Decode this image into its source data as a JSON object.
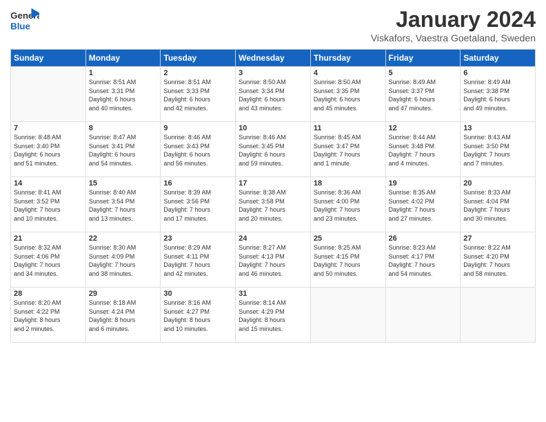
{
  "header": {
    "logo_general": "General",
    "logo_blue": "Blue",
    "month_title": "January 2024",
    "location": "Viskafors, Vaestra Goetaland, Sweden"
  },
  "weekdays": [
    "Sunday",
    "Monday",
    "Tuesday",
    "Wednesday",
    "Thursday",
    "Friday",
    "Saturday"
  ],
  "weeks": [
    [
      {
        "day": "",
        "info": ""
      },
      {
        "day": "1",
        "info": "Sunrise: 8:51 AM\nSunset: 3:31 PM\nDaylight: 6 hours\nand 40 minutes."
      },
      {
        "day": "2",
        "info": "Sunrise: 8:51 AM\nSunset: 3:33 PM\nDaylight: 6 hours\nand 42 minutes."
      },
      {
        "day": "3",
        "info": "Sunrise: 8:50 AM\nSunset: 3:34 PM\nDaylight: 6 hours\nand 43 minutes."
      },
      {
        "day": "4",
        "info": "Sunrise: 8:50 AM\nSunset: 3:35 PM\nDaylight: 6 hours\nand 45 minutes."
      },
      {
        "day": "5",
        "info": "Sunrise: 8:49 AM\nSunset: 3:37 PM\nDaylight: 6 hours\nand 47 minutes."
      },
      {
        "day": "6",
        "info": "Sunrise: 8:49 AM\nSunset: 3:38 PM\nDaylight: 6 hours\nand 49 minutes."
      }
    ],
    [
      {
        "day": "7",
        "info": "Sunrise: 8:48 AM\nSunset: 3:40 PM\nDaylight: 6 hours\nand 51 minutes."
      },
      {
        "day": "8",
        "info": "Sunrise: 8:47 AM\nSunset: 3:41 PM\nDaylight: 6 hours\nand 54 minutes."
      },
      {
        "day": "9",
        "info": "Sunrise: 8:46 AM\nSunset: 3:43 PM\nDaylight: 6 hours\nand 56 minutes."
      },
      {
        "day": "10",
        "info": "Sunrise: 8:46 AM\nSunset: 3:45 PM\nDaylight: 6 hours\nand 59 minutes."
      },
      {
        "day": "11",
        "info": "Sunrise: 8:45 AM\nSunset: 3:47 PM\nDaylight: 7 hours\nand 1 minute."
      },
      {
        "day": "12",
        "info": "Sunrise: 8:44 AM\nSunset: 3:48 PM\nDaylight: 7 hours\nand 4 minutes."
      },
      {
        "day": "13",
        "info": "Sunrise: 8:43 AM\nSunset: 3:50 PM\nDaylight: 7 hours\nand 7 minutes."
      }
    ],
    [
      {
        "day": "14",
        "info": "Sunrise: 8:41 AM\nSunset: 3:52 PM\nDaylight: 7 hours\nand 10 minutes."
      },
      {
        "day": "15",
        "info": "Sunrise: 8:40 AM\nSunset: 3:54 PM\nDaylight: 7 hours\nand 13 minutes."
      },
      {
        "day": "16",
        "info": "Sunrise: 8:39 AM\nSunset: 3:56 PM\nDaylight: 7 hours\nand 17 minutes."
      },
      {
        "day": "17",
        "info": "Sunrise: 8:38 AM\nSunset: 3:58 PM\nDaylight: 7 hours\nand 20 minutes."
      },
      {
        "day": "18",
        "info": "Sunrise: 8:36 AM\nSunset: 4:00 PM\nDaylight: 7 hours\nand 23 minutes."
      },
      {
        "day": "19",
        "info": "Sunrise: 8:35 AM\nSunset: 4:02 PM\nDaylight: 7 hours\nand 27 minutes."
      },
      {
        "day": "20",
        "info": "Sunrise: 8:33 AM\nSunset: 4:04 PM\nDaylight: 7 hours\nand 30 minutes."
      }
    ],
    [
      {
        "day": "21",
        "info": "Sunrise: 8:32 AM\nSunset: 4:06 PM\nDaylight: 7 hours\nand 34 minutes."
      },
      {
        "day": "22",
        "info": "Sunrise: 8:30 AM\nSunset: 4:09 PM\nDaylight: 7 hours\nand 38 minutes."
      },
      {
        "day": "23",
        "info": "Sunrise: 8:29 AM\nSunset: 4:11 PM\nDaylight: 7 hours\nand 42 minutes."
      },
      {
        "day": "24",
        "info": "Sunrise: 8:27 AM\nSunset: 4:13 PM\nDaylight: 7 hours\nand 46 minutes."
      },
      {
        "day": "25",
        "info": "Sunrise: 8:25 AM\nSunset: 4:15 PM\nDaylight: 7 hours\nand 50 minutes."
      },
      {
        "day": "26",
        "info": "Sunrise: 8:23 AM\nSunset: 4:17 PM\nDaylight: 7 hours\nand 54 minutes."
      },
      {
        "day": "27",
        "info": "Sunrise: 8:22 AM\nSunset: 4:20 PM\nDaylight: 7 hours\nand 58 minutes."
      }
    ],
    [
      {
        "day": "28",
        "info": "Sunrise: 8:20 AM\nSunset: 4:22 PM\nDaylight: 8 hours\nand 2 minutes."
      },
      {
        "day": "29",
        "info": "Sunrise: 8:18 AM\nSunset: 4:24 PM\nDaylight: 8 hours\nand 6 minutes."
      },
      {
        "day": "30",
        "info": "Sunrise: 8:16 AM\nSunset: 4:27 PM\nDaylight: 8 hours\nand 10 minutes."
      },
      {
        "day": "31",
        "info": "Sunrise: 8:14 AM\nSunset: 4:29 PM\nDaylight: 8 hours\nand 15 minutes."
      },
      {
        "day": "",
        "info": ""
      },
      {
        "day": "",
        "info": ""
      },
      {
        "day": "",
        "info": ""
      }
    ]
  ]
}
